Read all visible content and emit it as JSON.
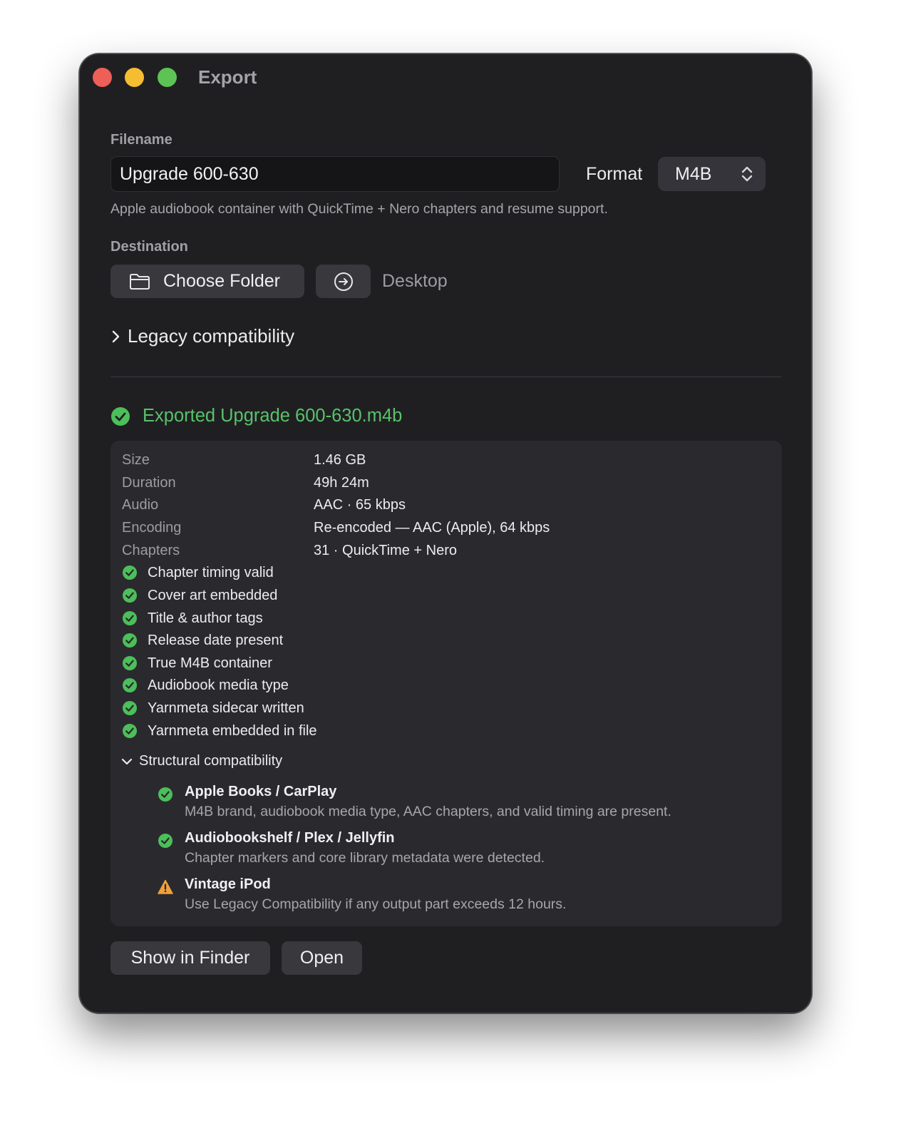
{
  "window": {
    "title": "Export"
  },
  "filename": {
    "label": "Filename",
    "value": "Upgrade 600-630"
  },
  "format": {
    "label": "Format",
    "value": "M4B",
    "description": "Apple audiobook container with QuickTime + Nero chapters and resume support."
  },
  "destination": {
    "label": "Destination",
    "choose_label": "Choose Folder",
    "path": "Desktop"
  },
  "legacy": {
    "label": "Legacy compatibility"
  },
  "status": {
    "message": "Exported Upgrade 600-630.m4b",
    "color": "#58c26a"
  },
  "details": [
    {
      "key": "Size",
      "value": "1.46 GB"
    },
    {
      "key": "Duration",
      "value": "49h 24m"
    },
    {
      "key": "Audio",
      "value": "AAC · 65 kbps"
    },
    {
      "key": "Encoding",
      "value": "Re-encoded — AAC (Apple), 64 kbps"
    },
    {
      "key": "Chapters",
      "value": "31 · QuickTime + Nero"
    }
  ],
  "checks": [
    "Chapter timing valid",
    "Cover art embedded",
    "Title & author tags",
    "Release date present",
    "True M4B container",
    "Audiobook media type",
    "Yarnmeta sidecar written",
    "Yarnmeta embedded in file"
  ],
  "structural": {
    "label": "Structural compatibility",
    "items": [
      {
        "title": "Apple Books / CarPlay",
        "desc": "M4B brand, audiobook media type, AAC chapters, and valid timing are present.",
        "status": "ok"
      },
      {
        "title": "Audiobookshelf / Plex / Jellyfin",
        "desc": "Chapter markers and core library metadata were detected.",
        "status": "ok"
      },
      {
        "title": "Vintage iPod",
        "desc": "Use Legacy Compatibility if any output part exceeds 12 hours.",
        "status": "warning"
      }
    ]
  },
  "actions": {
    "show_in_finder": "Show in Finder",
    "open": "Open"
  },
  "colors": {
    "ok": "#4cbf5a",
    "warning": "#f0a03c"
  }
}
